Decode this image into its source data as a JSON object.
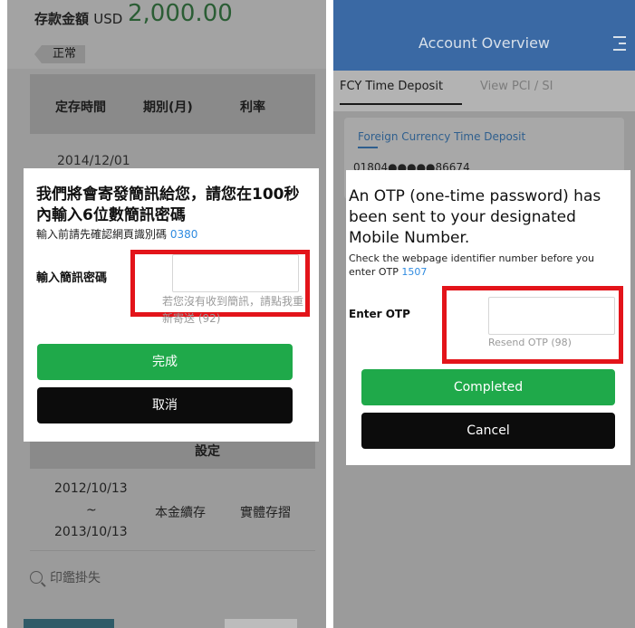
{
  "left": {
    "amount_label": "存款金額",
    "currency": "USD",
    "amount": "2,000.00",
    "status_badge": "正常",
    "table_headers": [
      "定存時間",
      "期別(月)",
      "利率"
    ],
    "row1_date": "2014/12/01",
    "settle_label": "設定",
    "row2": {
      "date_start": "2012/10/13",
      "date_sep": "~",
      "date_end": "2013/10/13",
      "renewal": "本金續存",
      "passbook": "實體存摺"
    },
    "report_loss": "印鑑掛失",
    "modal": {
      "title": "我們將會寄發簡訊給您，請您在100秒內輸入6位數簡訊密碼",
      "sub_prefix": "輸入前請先確認網頁識別碼",
      "identifier": "0380",
      "field_label": "輸入簡訊密碼",
      "resend_text": "若您沒有收到簡訊，請點我重新寄送 (92)",
      "complete_label": "完成",
      "cancel_label": "取消"
    }
  },
  "right": {
    "header_title": "Account Overview",
    "tabs": [
      "FCY Time Deposit",
      "View PCI / SI"
    ],
    "card_title": "Foreign Currency Time Deposit",
    "account_number": "01804●●●●●86674",
    "modal": {
      "title": "An OTP (one-time password) has been sent to your designated Mobile Number.",
      "sub_prefix": "Check the webpage identifier number before you enter OTP",
      "identifier": "1507",
      "field_label": "Enter OTP",
      "resend_text": "Resend OTP (98)",
      "complete_label": "Completed",
      "cancel_label": "Cancel"
    }
  },
  "colors": {
    "accent_blue": "#2f8be0",
    "button_green": "#1fa94a",
    "button_black": "#0c0c0c",
    "highlight_red": "#e3141a",
    "header_blue": "#3a69a4"
  }
}
